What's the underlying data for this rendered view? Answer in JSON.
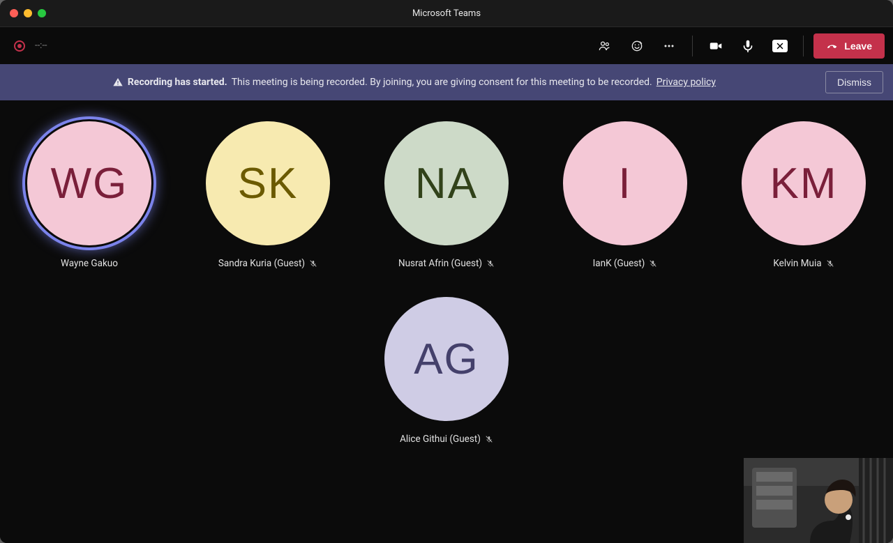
{
  "window": {
    "title": "Microsoft Teams"
  },
  "recording": {
    "timer": "--:--"
  },
  "toolbar": {
    "leave_label": "Leave"
  },
  "banner": {
    "heading": "Recording has started.",
    "body": "This meeting is being recorded. By joining, you are giving consent for this meeting to be recorded.",
    "policy_link": "Privacy policy",
    "dismiss_label": "Dismiss"
  },
  "participants": {
    "row1": [
      {
        "initials": "WG",
        "name": "Wayne Gakuo",
        "bg": "#f4c8d6",
        "fg": "#7a1f3a",
        "ring": true,
        "muted": false
      },
      {
        "initials": "SK",
        "name": "Sandra Kuria (Guest)",
        "bg": "#f7eab0",
        "fg": "#6b5a00",
        "ring": false,
        "muted": true
      },
      {
        "initials": "NA",
        "name": "Nusrat Afrin (Guest)",
        "bg": "#cddac8",
        "fg": "#31421a",
        "ring": false,
        "muted": true
      },
      {
        "initials": "I",
        "name": "IanK (Guest)",
        "bg": "#f4c8d6",
        "fg": "#7a1f3a",
        "ring": false,
        "muted": true
      },
      {
        "initials": "KM",
        "name": "Kelvin Muia",
        "bg": "#f4c8d6",
        "fg": "#7a1f3a",
        "ring": false,
        "muted": true
      }
    ],
    "row2": [
      {
        "initials": "AG",
        "name": "Alice Githui (Guest)",
        "bg": "#cfcce5",
        "fg": "#44406b",
        "ring": false,
        "muted": true
      }
    ]
  }
}
